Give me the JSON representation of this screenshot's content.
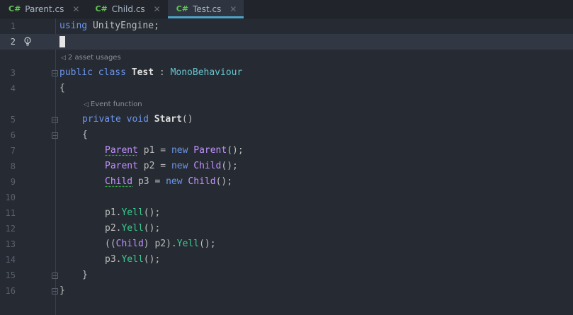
{
  "tabs": [
    {
      "lang": "C#",
      "label": "Parent.cs",
      "active": false
    },
    {
      "lang": "C#",
      "label": "Child.cs",
      "active": false
    },
    {
      "lang": "C#",
      "label": "Test.cs",
      "active": true
    }
  ],
  "editor": {
    "line_numbers": [
      "1",
      "2",
      "3",
      "4",
      "5",
      "6",
      "7",
      "8",
      "9",
      "10",
      "11",
      "12",
      "13",
      "14",
      "15",
      "16"
    ],
    "hints": {
      "asset_usages": "2 asset usages",
      "event_function": "Event function"
    },
    "code": {
      "l1_using": "using",
      "l1_ns": "UnityEngine",
      "l1_semi": ";",
      "l3_public": "public",
      "l3_class": "class",
      "l3_name": "Test",
      "l3_colon": " : ",
      "l3_base": "MonoBehaviour",
      "l4": "{",
      "l5_private": "private",
      "l5_void": "void",
      "l5_name": "Start",
      "l5_paren": "()",
      "l6": "{",
      "l7_type": "Parent",
      "l7_var": " p1 = ",
      "l7_new": "new",
      "l7_ctor": "Parent",
      "l7_end": "();",
      "l8_type": "Parent",
      "l8_var": " p2 = ",
      "l8_new": "new",
      "l8_ctor": "Child",
      "l8_end": "();",
      "l9_type": "Child",
      "l9_var": " p3 = ",
      "l9_new": "new",
      "l9_ctor": "Child",
      "l9_end": "();",
      "l11_var": "p1.",
      "l11_call": "Yell",
      "l11_end": "();",
      "l12_var": "p2.",
      "l12_call": "Yell",
      "l12_end": "();",
      "l13_open": "((",
      "l13_type": "Child",
      "l13_mid": ") p2).",
      "l13_call": "Yell",
      "l13_end": "();",
      "l14_var": "p3.",
      "l14_call": "Yell",
      "l14_end": "();",
      "l15": "}",
      "l16": "}"
    }
  },
  "colors": {
    "keyword": "#6c95eb",
    "type": "#c191ff",
    "class_name": "#66c3cc",
    "method": "#39cc8f",
    "cs_badge": "#62c554",
    "active_tab_underline": "#4aa3c8"
  }
}
